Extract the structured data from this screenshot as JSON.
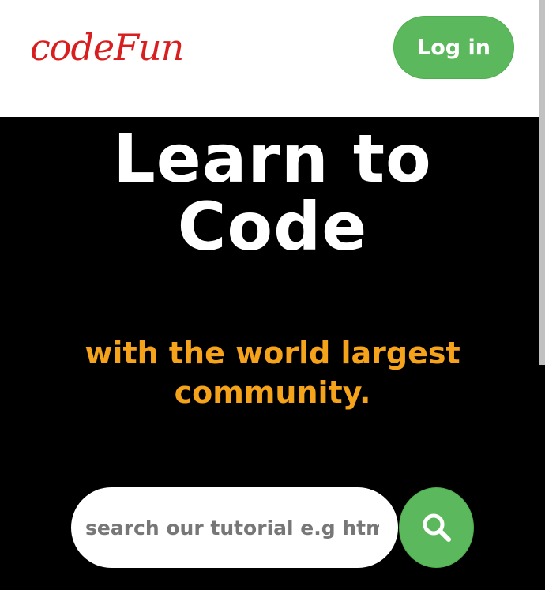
{
  "header": {
    "logo_text": "codeFun",
    "login_label": "Log in"
  },
  "hero": {
    "title_line1": "Learn to",
    "title_line2": "Code",
    "subtitle_line1": "with the world largest",
    "subtitle_line2": "community."
  },
  "search": {
    "placeholder": "search our tutorial e.g html, css",
    "value": "",
    "button_icon": "search-icon"
  },
  "colors": {
    "logo": "#d81e1e",
    "accent_green": "#5cb85c",
    "subtitle_orange": "#f5a31a",
    "hero_background": "#000000",
    "header_background": "#ffffff"
  }
}
